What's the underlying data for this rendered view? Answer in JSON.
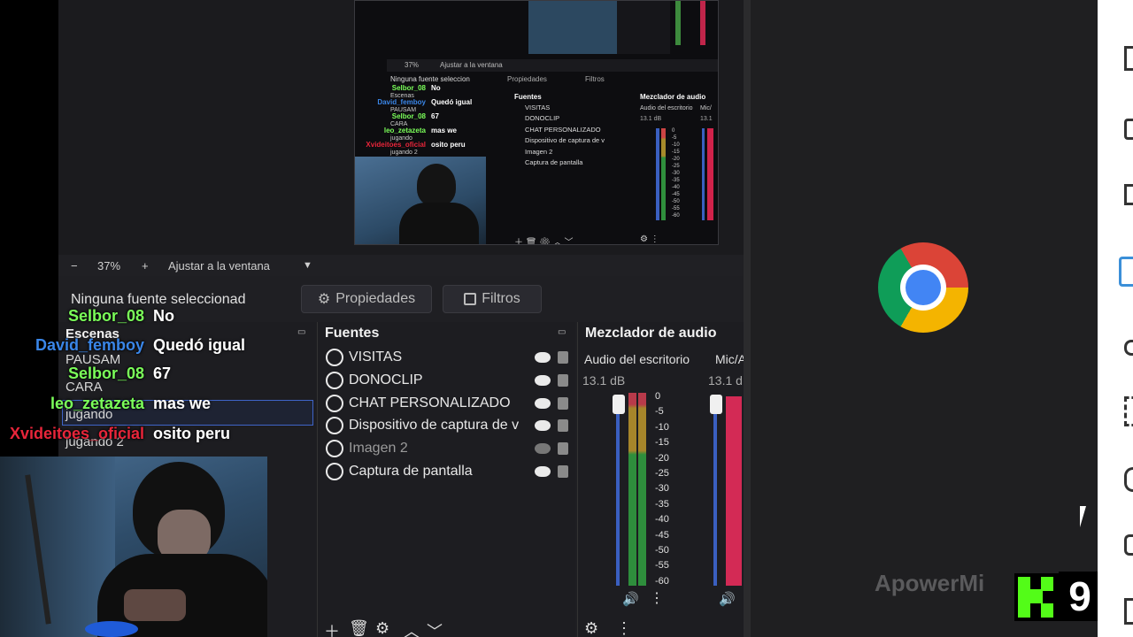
{
  "zoom": {
    "minus": "−",
    "value": "37%",
    "plus": "+",
    "fit_label": "Ajustar a la ventana",
    "caret": "▼"
  },
  "properties": {
    "no_source": "Ninguna fuente seleccionad",
    "props_label": "Propiedades",
    "filters_label": "Filtros"
  },
  "scenes": {
    "title": "Escenas",
    "items": [
      "PAUSAM",
      "CARA",
      "jugando",
      "jugando 2"
    ]
  },
  "sources": {
    "title": "Fuentes",
    "items": [
      {
        "label": "VISITAS",
        "visible": true
      },
      {
        "label": "DONOCLIP",
        "visible": true
      },
      {
        "label": "CHAT PERSONALIZADO",
        "visible": true
      },
      {
        "label": "Dispositivo de captura de v",
        "visible": true
      },
      {
        "label": "Imagen 2",
        "visible": false
      },
      {
        "label": "Captura de pantalla",
        "visible": true
      }
    ]
  },
  "mixer": {
    "title": "Mezclador de audio",
    "ch1_label": "Audio del escritorio",
    "ch2_label": "Mic/A",
    "ch1_db": "13.1 dB",
    "ch2_db": "13.1 d",
    "ticks": [
      "0",
      "-5",
      "-10",
      "-15",
      "-20",
      "-25",
      "-30",
      "-35",
      "-40",
      "-45",
      "-50",
      "-55",
      "-60"
    ]
  },
  "chat": [
    {
      "user": "Selbor_08",
      "msg": "No",
      "color": "#7bff5a"
    },
    {
      "user": "David_femboy",
      "msg": "Quedó igual",
      "color": "#3a86e8"
    },
    {
      "user": "Selbor_08",
      "msg": "67",
      "color": "#7bff5a"
    },
    {
      "user": "leo_zetazeta",
      "msg": "mas we",
      "color": "#7bff5a"
    },
    {
      "user": "Xvideitoes_oficial",
      "msg": "osito peru",
      "color": "#e8253a"
    }
  ],
  "mini": {
    "zoom": "37%",
    "fit": "Ajustar a la ventana",
    "no_source": "Ninguna fuente seleccion",
    "props": "Propiedades",
    "filters": "Filtros",
    "fuentes": "Fuentes",
    "mixer": "Mezclador de audio",
    "audio": "Audio del escritorio",
    "mic": "Mic/",
    "db": "13.1 dB",
    "db2": "13.1",
    "sources": [
      "VISITAS",
      "DONOCLIP",
      "CHAT PERSONALIZADO",
      "Dispositivo de captura de v",
      "Imagen 2",
      "Captura de pantalla"
    ],
    "chat": [
      [
        "Selbor_08",
        "No"
      ],
      [
        "David_femboy",
        "Quedó igual"
      ],
      [
        "Selbor_08",
        "67"
      ],
      [
        "leo_zetazeta",
        "mas we"
      ],
      [
        "Xvideitoes_oficial",
        "osito peru"
      ]
    ],
    "scenes": [
      "Escenas",
      "PAUSAM",
      "CARA",
      "jugando",
      "jugando 2"
    ],
    "ticks": [
      "0",
      "-5",
      "-10",
      "-15",
      "-20",
      "-25",
      "-30",
      "-35",
      "-40",
      "-45",
      "-50",
      "-55",
      "-60"
    ]
  },
  "watermark": "ApowerMirr",
  "kick_number": "9",
  "colors": {
    "accent_green": "#53fc18",
    "chrome_red": "#db4437",
    "chrome_yellow": "#f4b400",
    "chrome_green": "#0f9d58",
    "chrome_blue": "#4285f4"
  }
}
